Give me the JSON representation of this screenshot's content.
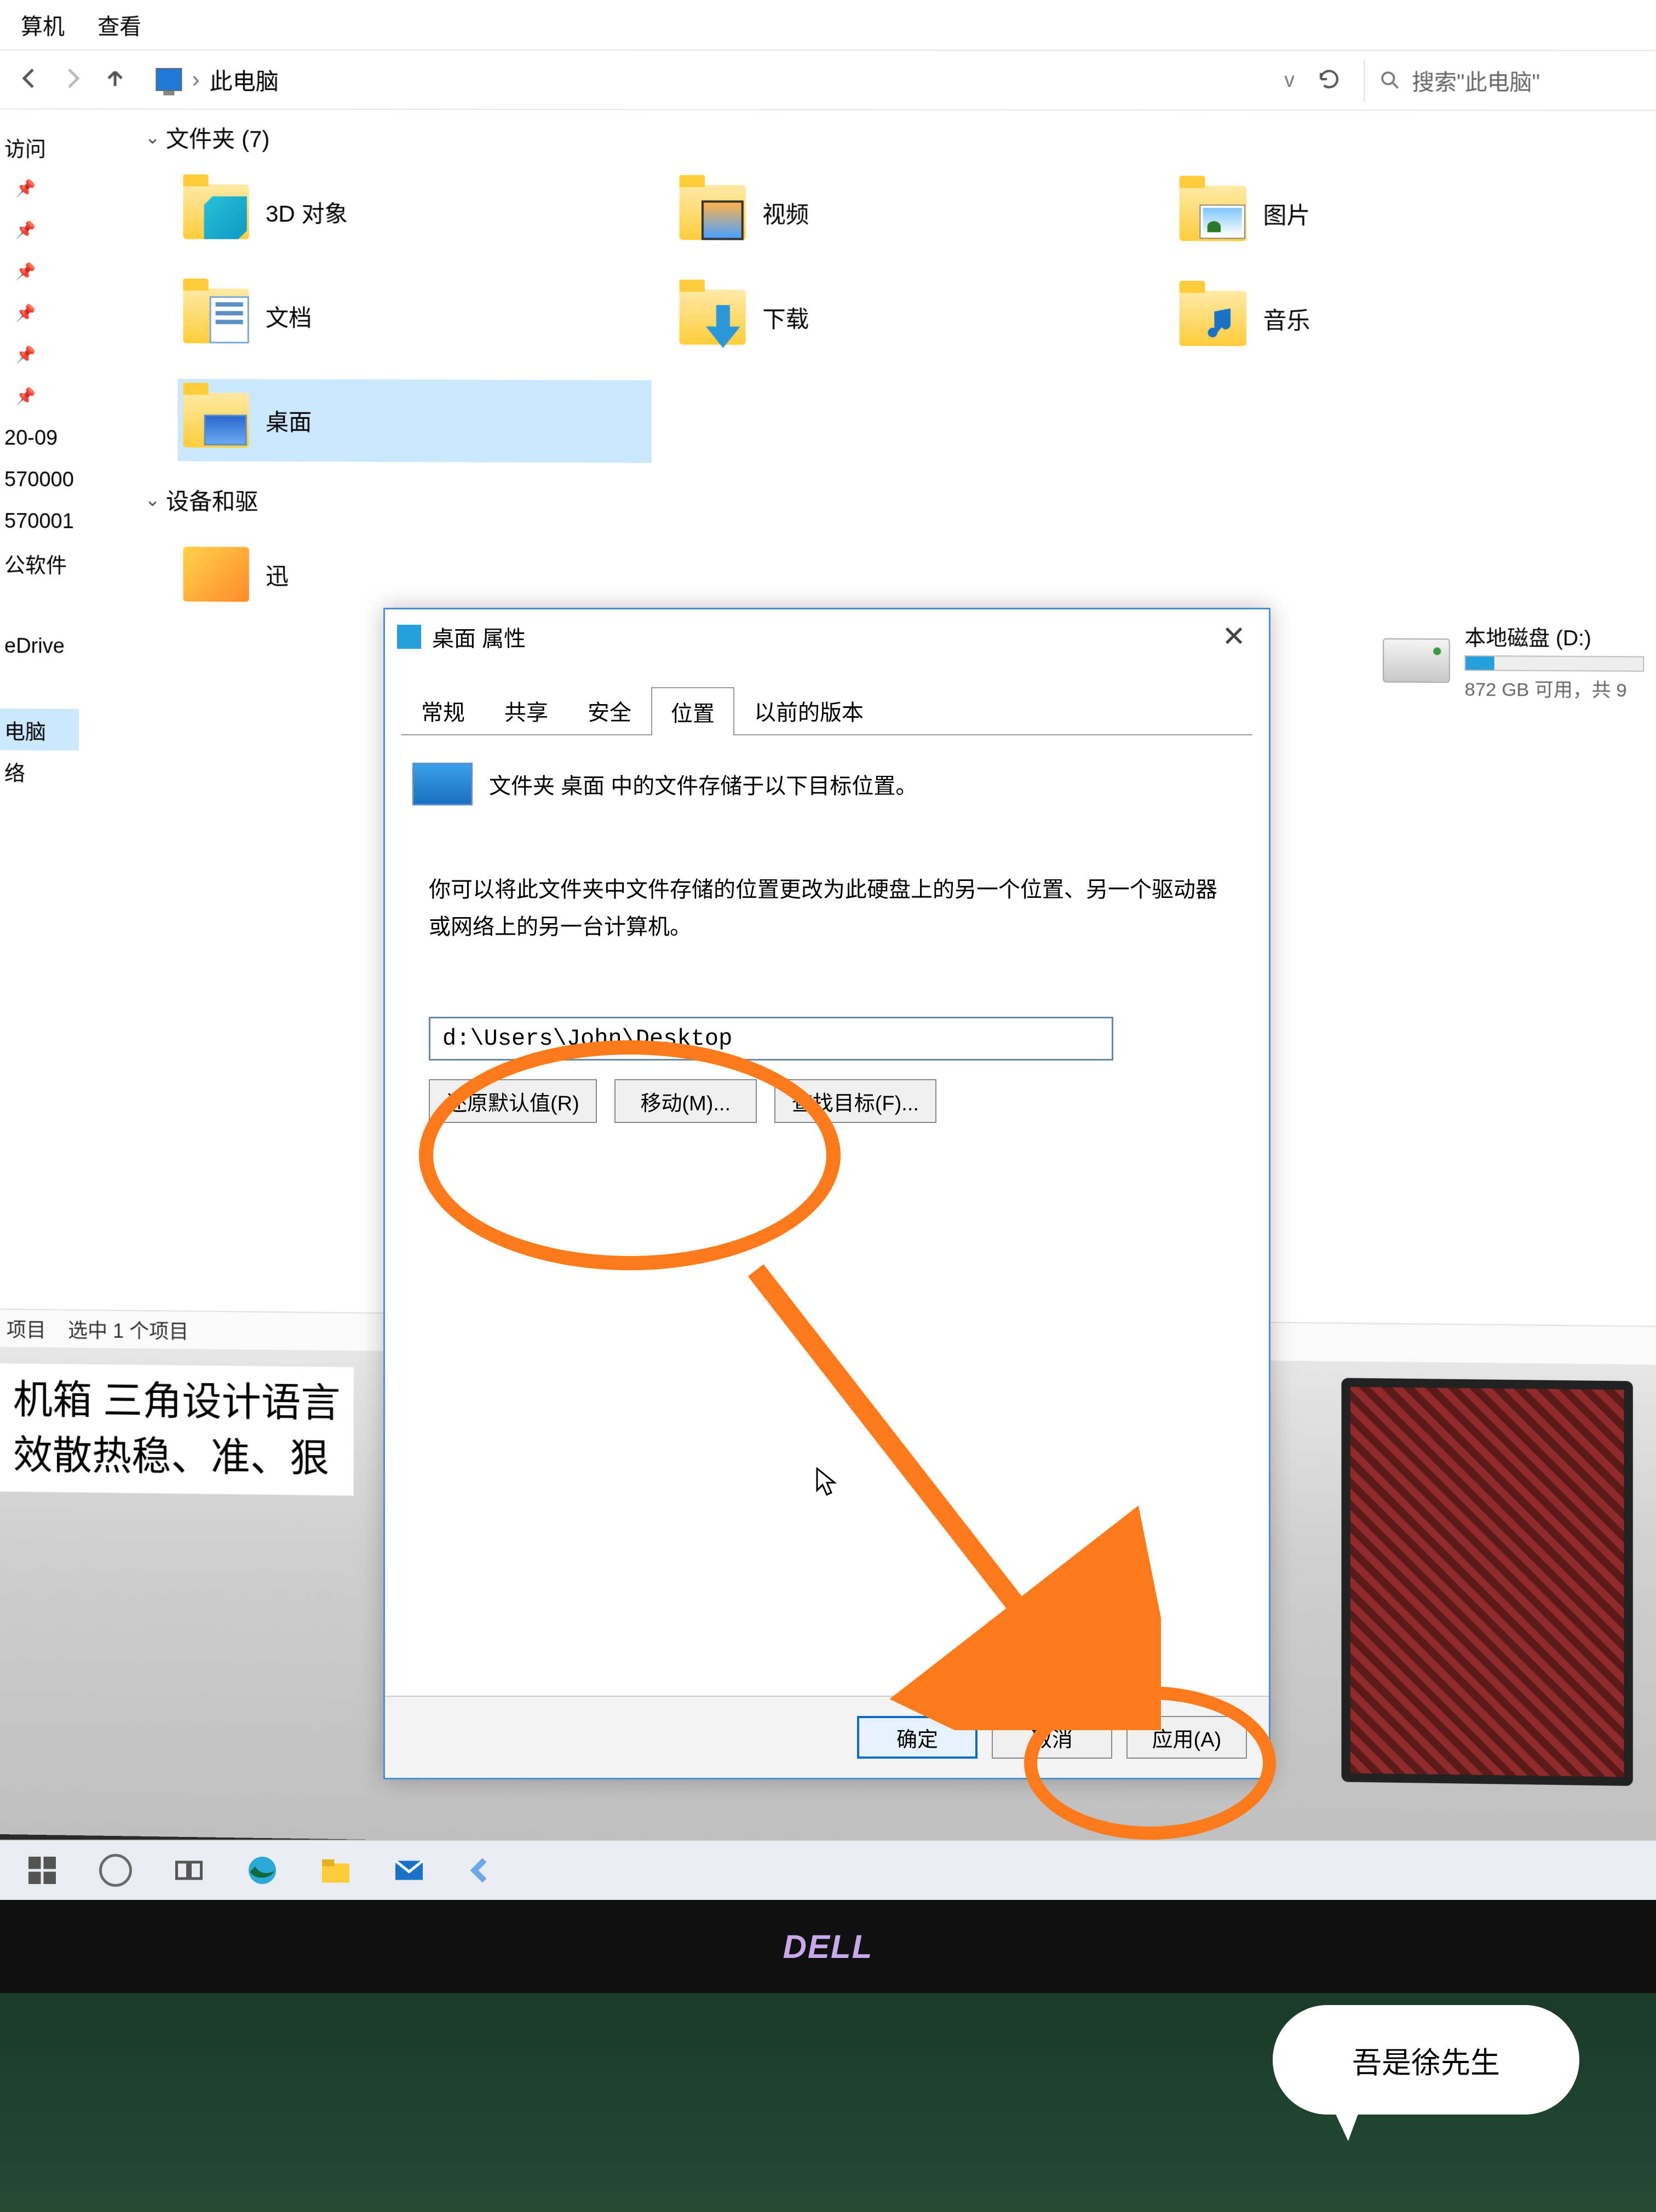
{
  "menu": {
    "computer": "算机",
    "view": "查看"
  },
  "address": {
    "path_label": "此电脑",
    "sep": "›",
    "refresh_tip": "刷新",
    "search_placeholder": "搜索\"此电脑\""
  },
  "sidebar": {
    "items": [
      "访问",
      "",
      "",
      "",
      "",
      "",
      "",
      "20-09",
      "570000",
      "570001",
      "公软件",
      "",
      "eDrive",
      "",
      "电脑",
      "络"
    ]
  },
  "groups": {
    "folders_header": "文件夹 (7)",
    "devices_header": "设备和驱"
  },
  "folders": [
    {
      "label": "3D 对象",
      "icon": "3d"
    },
    {
      "label": "视频",
      "icon": "video"
    },
    {
      "label": "图片",
      "icon": "pic"
    },
    {
      "label": "文档",
      "icon": "doc"
    },
    {
      "label": "下载",
      "icon": "dl"
    },
    {
      "label": "音乐",
      "icon": "music"
    },
    {
      "label": "桌面",
      "icon": "desk",
      "selected": true
    }
  ],
  "devices": {
    "xunlei": "迅",
    "drive_d": {
      "title": "本地磁盘 (D:)",
      "free": "872 GB 可用，共 9"
    }
  },
  "statusbar": {
    "left": "项目",
    "selected": "选中 1 个项目"
  },
  "bg_text_lines": [
    "机箱  三角设计语言",
    "效散热稳、准、狠"
  ],
  "dialog": {
    "title": "桌面 属性",
    "tabs": [
      "常规",
      "共享",
      "安全",
      "位置",
      "以前的版本"
    ],
    "active_tab": "位置",
    "line1": "文件夹 桌面 中的文件存储于以下目标位置。",
    "desc": "你可以将此文件夹中文件存储的位置更改为此硬盘上的另一个位置、另一个驱动器或网络上的另一台计算机。",
    "path": "d:\\Users\\John\\Desktop",
    "btn_restore": "还原默认值(R)",
    "btn_move": "移动(M)...",
    "btn_find": "查找目标(F)...",
    "btn_ok": "确定",
    "btn_cancel": "取消",
    "btn_apply": "应用(A)"
  },
  "taskbar_brand": "DELL",
  "speech": "吾是徐先生"
}
